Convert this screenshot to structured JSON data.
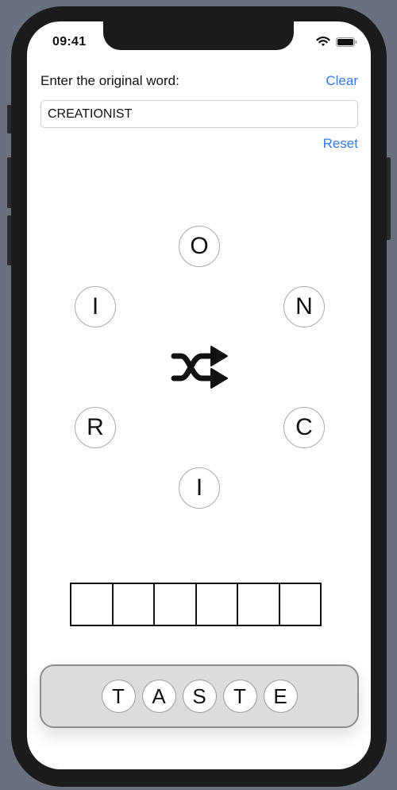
{
  "status_bar": {
    "time": "09:41",
    "icons": [
      "wifi-icon",
      "battery-icon"
    ]
  },
  "form": {
    "prompt_label": "Enter the original word:",
    "clear_label": "Clear",
    "word_value": "CREATIONIST",
    "reset_label": "Reset"
  },
  "wheel": {
    "letters": [
      "O",
      "N",
      "C",
      "I",
      "R",
      "I"
    ],
    "center_icon": "shuffle-icon"
  },
  "answer_slots": {
    "count": 6,
    "filled": [
      "",
      "",
      "",
      "",
      "",
      ""
    ]
  },
  "tray": {
    "letters": [
      "T",
      "A",
      "S",
      "T",
      "E"
    ]
  },
  "colors": {
    "accent": "#2f7bf0",
    "tray_fill": "#dcdcdc",
    "tray_border": "#8e8e8e",
    "frame": "#1b1b1b",
    "background": "#68717d"
  }
}
